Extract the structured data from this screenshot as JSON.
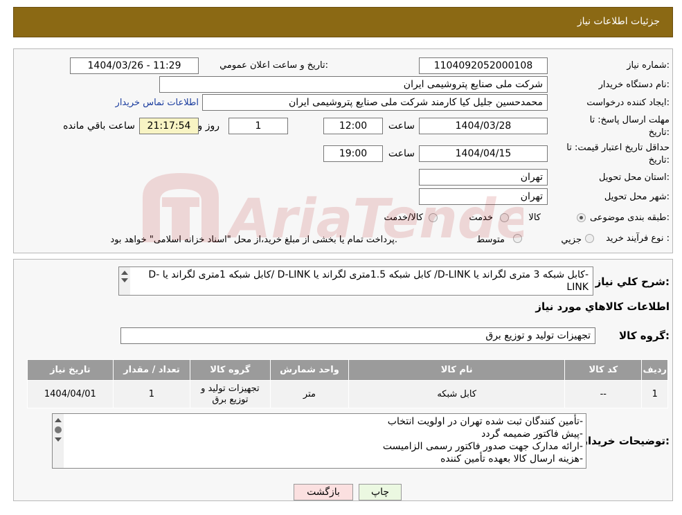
{
  "header": {
    "title": "جزئيات اطلاعات نياز"
  },
  "form": {
    "need_number_label": "شماره نياز:",
    "need_number": "1104092052000108",
    "announce_label": "تاريخ و ساعت اعلان عمومي:",
    "announce_value": "1404/03/26 - 11:29",
    "buyer_label": "نام دستگاه خريدار:",
    "buyer_value": "شرکت ملی صنایع پتروشیمی ایران",
    "creator_label": "ايجاد کننده درخواست:",
    "creator_value": "محمدحسین جلیل کیا کارمند شرکت ملی صنایع پتروشیمی ایران",
    "contact_link": "اطلاعات تماس خريدار",
    "deadline_label_1": "مهلت ارسال پاسخ: تا",
    "deadline_label_2": "تاريخ:",
    "deadline_date": "1404/03/28",
    "time_label": "ساعت",
    "deadline_time": "12:00",
    "days_value": "1",
    "days_label": "روز و",
    "remaining_value": "21:17:54",
    "remaining_label": "ساعت باقي مانده",
    "validity_label_1": "حداقل تاريخ اعتبار قيمت: تا",
    "validity_label_2": "تاريخ:",
    "validity_date": "1404/04/15",
    "validity_time": "19:00",
    "province_label": "استان محل تحويل:",
    "province_value": "تهران",
    "city_label": "شهر محل تحويل:",
    "city_value": "تهران",
    "category_label": "طبقه بندی موضوعی:",
    "category_options": [
      "کالا",
      "خدمت",
      "کالا/خدمت"
    ],
    "category_selected": "کالا",
    "process_label": "نوع فرآيند خريد :",
    "process_options": [
      "جزيي",
      "متوسط"
    ],
    "process_note": "پرداخت تمام يا بخشی از مبلغ خريد،از محل \"اسناد خزانه اسلامی\" خواهد بود."
  },
  "summary": {
    "label": "شرح کلي نياز:",
    "text": "-کابل شبکه 3 متری لگراند یا D-LINK/ کابل شبکه 1.5متری لگراند یا D-LINK /کابل شبکه 1متری لگراند یا D-LINK"
  },
  "goods": {
    "section_title": "اطلاعات کالاهاي مورد نياز",
    "group_label": "گروه کالا:",
    "group_value": "تجهيزات توليد و توزيع برق",
    "columns": [
      "رديف",
      "کد کالا",
      "نام کالا",
      "واحد شمارش",
      "گروه کالا",
      "تعداد / مقدار",
      "تاريخ نياز"
    ],
    "rows": [
      {
        "row": "1",
        "code": "--",
        "name": "کابل شبکه",
        "unit": "متر",
        "group_line1": "تجهيزات توليد و",
        "group_line2": "توزيع برق",
        "qty": "1",
        "date": "1404/04/01"
      }
    ]
  },
  "notes": {
    "label": "توضيحات خريدار:",
    "lines": [
      "-تأمین کنندگان ثبت شده تهران در اولویت انتخاب",
      "-پیش فاکتور ضمیمه گردد",
      "-ارائه مدارک جهت صدور فاکتور رسمی الزامیست",
      "-هزینه ارسال کالا بعهده تأمین کننده"
    ]
  },
  "buttons": {
    "print": "چاپ",
    "back": "بازگشت"
  },
  "watermark": {
    "text": "AriaTender.neT"
  },
  "colors": {
    "header": "#8b6914",
    "table_header": "#9b9b9b",
    "link": "#1a3c9e",
    "timer_bg": "#f8f4c4",
    "print_bg": "#ebf8e1",
    "back_bg": "#fbe0e0"
  }
}
